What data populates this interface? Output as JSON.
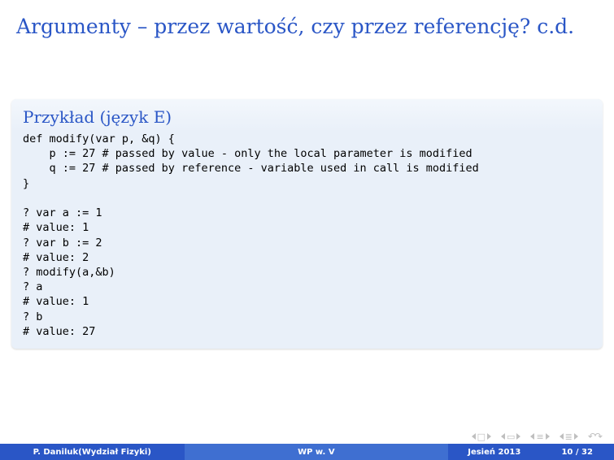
{
  "title": "Argumenty – przez wartość, czy przez referencję? c.d.",
  "block": {
    "title": "Przykład (język E)",
    "code": "def modify(var p, &q) {\n    p := 27 # passed by value - only the local parameter is modified\n    q := 27 # passed by reference - variable used in call is modified\n}\n\n? var a := 1\n# value: 1\n? var b := 2\n# value: 2\n? modify(a,&b)\n? a\n# value: 1\n? b\n# value: 27"
  },
  "footer": {
    "author": "P. Daniluk(Wydział Fizyki)",
    "middle": "WP w. V",
    "date": "Jesień 2013",
    "page": "10 / 32"
  },
  "nav": {
    "icons": [
      "frame-back",
      "frame-fwd",
      "sheet-back",
      "sheet-fwd",
      "sect-back",
      "sect-fwd",
      "sub-back",
      "sub-fwd",
      "redo"
    ]
  }
}
